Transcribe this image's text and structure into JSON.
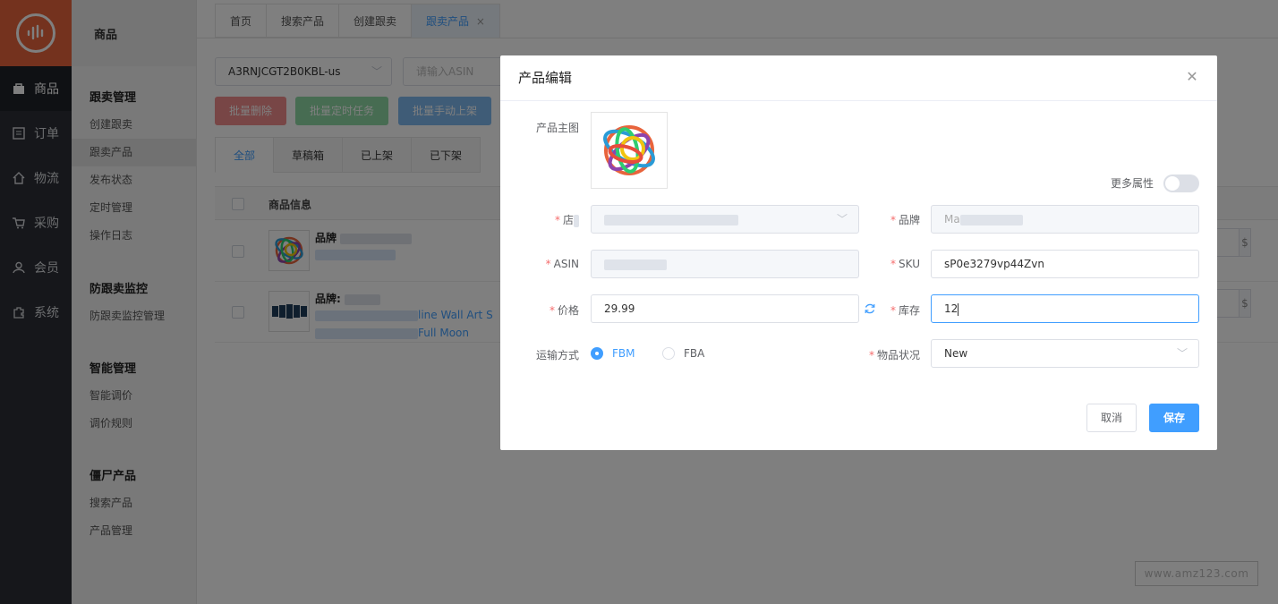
{
  "nav": {
    "items": [
      {
        "label": "商品",
        "icon": "bag-icon"
      },
      {
        "label": "订单",
        "icon": "list-icon"
      },
      {
        "label": "物流",
        "icon": "home-icon"
      },
      {
        "label": "采购",
        "icon": "cart-icon"
      },
      {
        "label": "会员",
        "icon": "user-icon"
      },
      {
        "label": "系统",
        "icon": "puzzle-icon"
      }
    ]
  },
  "submenu": {
    "title": "商品",
    "groups": [
      {
        "title": "跟卖管理",
        "items": [
          "创建跟卖",
          "跟卖产品",
          "发布状态",
          "定时管理",
          "操作日志"
        ]
      },
      {
        "title": "防跟卖监控",
        "items": [
          "防跟卖监控管理"
        ]
      },
      {
        "title": "智能管理",
        "items": [
          "智能调价",
          "调价规则"
        ]
      },
      {
        "title": "僵尸产品",
        "items": [
          "搜索产品",
          "产品管理"
        ]
      }
    ]
  },
  "tabs": [
    "首页",
    "搜索产品",
    "创建跟卖",
    "跟卖产品"
  ],
  "toolbar": {
    "store_select": "A3RNJCGT2B0KBL-us",
    "asin_placeholder": "请输入ASIN",
    "btn_delete": "批量删除",
    "btn_schedule": "批量定时任务",
    "btn_publish": "批量手动上架"
  },
  "filter_tabs": [
    "全部",
    "草稿箱",
    "已上架",
    "已下架"
  ],
  "table": {
    "header": "商品信息",
    "rows": [
      {
        "brand": "品牌"
      },
      {
        "brand": "品牌:",
        "title1": "line Wall Art S",
        "title2": "Full Moon"
      }
    ],
    "currency": "$"
  },
  "watermark": "www.amz123.com",
  "dialog": {
    "title": "产品编辑",
    "main_image_label": "产品主图",
    "more_attrs_label": "更多属性",
    "store_label": "店",
    "brand_label": "品牌",
    "brand_value": "Ma",
    "asin_label": "ASIN",
    "sku_label": "SKU",
    "sku_value": "sP0e3279vp44Zvn",
    "price_label": "价格",
    "price_value": "29.99",
    "stock_label": "库存",
    "stock_value": "12",
    "shipping_label": "运输方式",
    "shipping_options": [
      "FBM",
      "FBA"
    ],
    "condition_label": "物品状况",
    "condition_value": "New",
    "cancel": "取消",
    "save": "保存"
  },
  "colors": {
    "primary": "#409eff",
    "brand": "#e8643c",
    "nav_bg": "#2c2f36"
  }
}
